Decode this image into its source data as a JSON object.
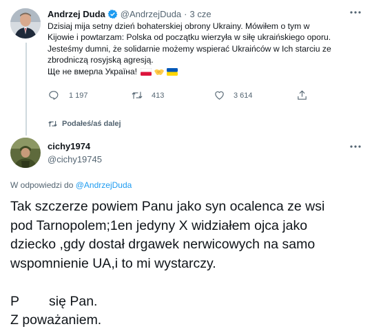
{
  "colors": {
    "accent": "#1d9bf0",
    "text": "#0f1419",
    "muted": "#536471",
    "line": "#cfd9de"
  },
  "parent_tweet": {
    "author_name": "Andrzej Duda",
    "author_handle": "@AndrzejDuda",
    "separator": "·",
    "time": "3 cze",
    "text_lines": [
      "Dzisiaj mija setny dzień bohaterskiej obrony Ukrainy. Mówiłem o tym w",
      "Kijowie i powtarzam: Polska od początku wierzyła w siłę ukraińskiego oporu.",
      "Jesteśmy dumni, że solidarnie możemy wspierać Ukraińców w Ich starciu ze",
      "zbrodniczą rosyjską agresją.",
      "Ще не вмерла Україна!"
    ],
    "metrics": {
      "replies": "1 197",
      "retweets": "413",
      "likes": "3 614"
    },
    "retweeted_note": "Podałeś/aś dalej",
    "icons": [
      "verified-badge",
      "more-icon",
      "reply-icon",
      "retweet-icon",
      "like-icon",
      "share-icon",
      "flag-poland",
      "handshake-emoji",
      "flag-ukraine"
    ]
  },
  "reply_tweet": {
    "author_name": "cichy1974",
    "author_handle": "@cichy19745",
    "replying_prefix": "W odpowiedzi do",
    "replying_to": "@AndrzejDuda",
    "text_lines": [
      "Tak szczerze powiem Panu jako syn ocalenca ze wsi",
      "pod Tarnopolem;1en jedyny X widziałem ojca jako",
      "dziecko ,gdy dostał drgawek nerwicowych na samo",
      "wspomnienie UA,i to mi wystarczy.",
      "",
      "P        się Pan.",
      "Z poważaniem."
    ]
  }
}
